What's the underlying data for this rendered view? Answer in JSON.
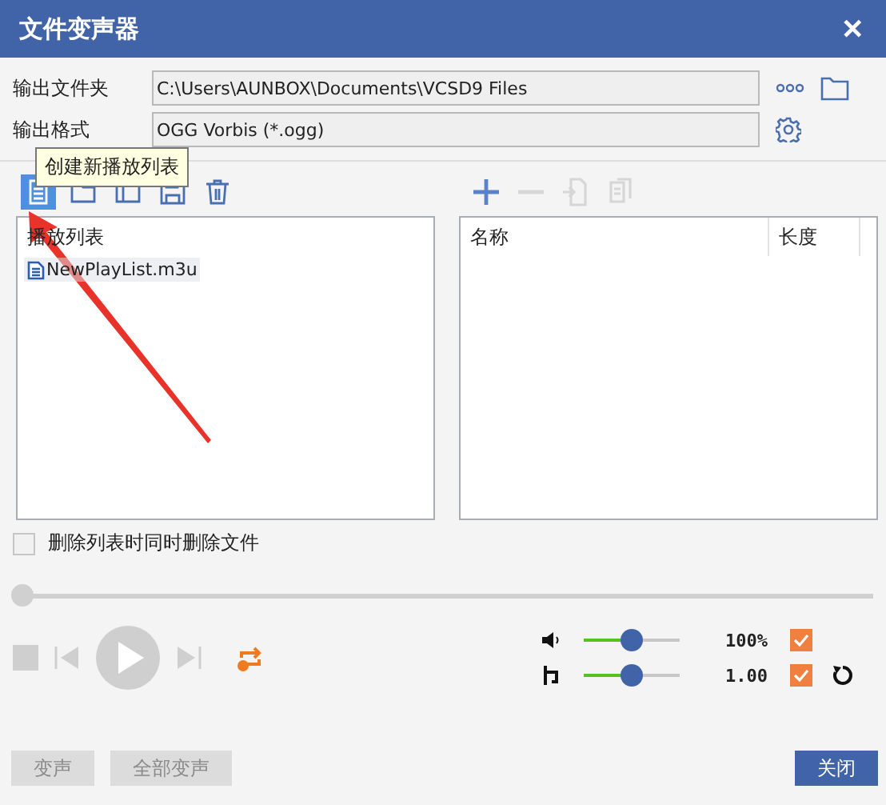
{
  "window": {
    "title": "文件变声器",
    "close": "✕"
  },
  "output_folder": {
    "label": "输出文件夹",
    "value": "C:\\Users\\AUNBOX\\Documents\\VCSD9 Files"
  },
  "output_format": {
    "label": "输出格式",
    "value": "OGG Vorbis (*.ogg)"
  },
  "tooltip": "创建新播放列表",
  "playlist_toolbar": [
    {
      "kind": "new",
      "selected": true
    },
    {
      "kind": "open",
      "selected": false
    },
    {
      "kind": "rename",
      "selected": false
    },
    {
      "kind": "save",
      "selected": false
    },
    {
      "kind": "delete",
      "selected": false
    }
  ],
  "file_toolbar": [
    {
      "kind": "add",
      "disabled": false
    },
    {
      "kind": "remove",
      "disabled": true
    },
    {
      "kind": "import",
      "disabled": true
    },
    {
      "kind": "copy",
      "disabled": true
    }
  ],
  "playlists": {
    "header": "播放列表",
    "items": [
      {
        "name": "NewPlayList.m3u",
        "selected": true
      }
    ]
  },
  "files": {
    "columns": [
      "名称",
      "长度"
    ]
  },
  "delete_files": {
    "label": "删除列表时同时删除文件",
    "checked": false
  },
  "seek": {
    "level": 0
  },
  "playback": {
    "disabled": true
  },
  "volume": {
    "level": 0.5,
    "reading": "100%",
    "checked": true
  },
  "pitch": {
    "level": 0.5,
    "reading": "1.00",
    "checked": true
  },
  "buttons": [
    {
      "label": "变声",
      "disabled": true
    },
    {
      "label": "全部变声",
      "disabled": true
    },
    {
      "label": "关闭",
      "disabled": false
    }
  ]
}
